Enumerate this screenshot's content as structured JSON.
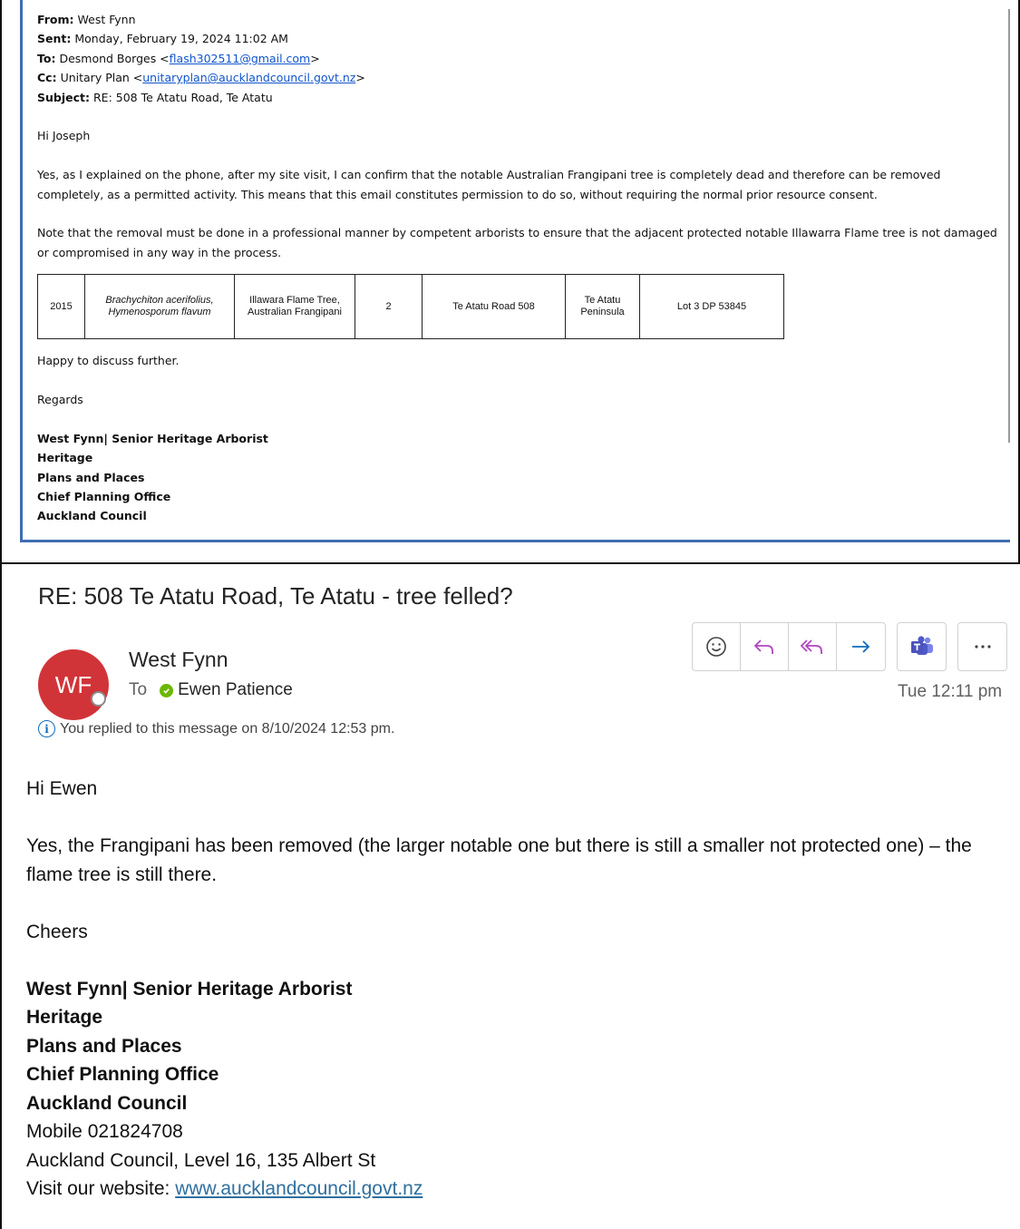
{
  "quoted_email": {
    "headers": [
      {
        "label": "From:",
        "value": "West Fynn"
      },
      {
        "label": "Sent:",
        "value": "Monday, February 19, 2024 11:02 AM"
      },
      {
        "label": "To:",
        "value": "Desmond Borges <",
        "link": "flash302511@gmail.com",
        "suffix": ">"
      },
      {
        "label": "Cc:",
        "value": "Unitary Plan <",
        "link": "unitaryplan@aucklandcouncil.govt.nz",
        "suffix": ">"
      },
      {
        "label": "Subject:",
        "value": "RE: 508 Te Atatu Road, Te Atatu"
      }
    ],
    "greeting": "Hi Joseph",
    "para1": "Yes, as I explained on the phone, after my site visit, I can confirm that the notable Australian Frangipani tree is completely dead and therefore can be removed completely, as a permitted activity. This means that this email constitutes permission to do so, without requiring the normal prior resource consent.",
    "para2": "Note that the removal must be done in a professional manner by competent arborists to ensure that the adjacent protected notable Illawarra Flame tree is not damaged or compromised in any way in the process.",
    "table": {
      "cells": [
        {
          "line1": "2015",
          "line2": "",
          "italic": false
        },
        {
          "line1": "Brachychiton acerifolius,",
          "line2": "Hymenosporum flavum",
          "italic": true
        },
        {
          "line1": "Illawara Flame Tree,",
          "line2": "Australian Frangipani",
          "italic": false
        },
        {
          "line1": "2",
          "line2": "",
          "italic": false
        },
        {
          "line1": "Te Atatu Road 508",
          "line2": "",
          "italic": false
        },
        {
          "line1": "Te Atatu",
          "line2": "Peninsula",
          "italic": false
        },
        {
          "line1": "Lot 3 DP 53845",
          "line2": "",
          "italic": false
        }
      ]
    },
    "closing": "Happy to discuss further.",
    "regards": "Regards",
    "signature": [
      "West Fynn| Senior Heritage Arborist",
      "Heritage",
      "Plans and Places",
      "Chief Planning Office",
      "Auckland Council"
    ]
  },
  "reply_email": {
    "subject": "RE: 508 Te Atatu Road, Te Atatu - tree felled?",
    "avatar_initials": "WF",
    "sender": "West Fynn",
    "to_label": "To",
    "recipient": "Ewen Patience",
    "timestamp": "Tue 12:11 pm",
    "info": "You replied to this message on 8/10/2024 12:53 pm.",
    "toolbar": {
      "react": "smile-icon",
      "reply": "reply-icon",
      "reply_all": "reply-all-icon",
      "forward": "forward-icon",
      "teams": "teams-icon",
      "more": "more-icon"
    },
    "greeting": "Hi Ewen",
    "body": "Yes, the Frangipani has been removed (the larger notable one but there is still a smaller not protected one) – the flame tree is still there.",
    "closing": "Cheers",
    "signature": [
      "West Fynn| Senior Heritage Arborist",
      "Heritage",
      "Plans and Places",
      "Chief Planning Office",
      "Auckland Council"
    ],
    "mobile": "Mobile 021824708",
    "address": "Auckland Council, Level 16, 135 Albert St",
    "website_label": "Visit our website: ",
    "website_link": "www.aucklandcouncil.govt.nz"
  },
  "colors": {
    "accent_blue": "#3f6db3",
    "avatar_red": "#d13438",
    "presence_green": "#6bb700",
    "reply_purple": "#b146c2",
    "link_blue": "#1155cc"
  }
}
